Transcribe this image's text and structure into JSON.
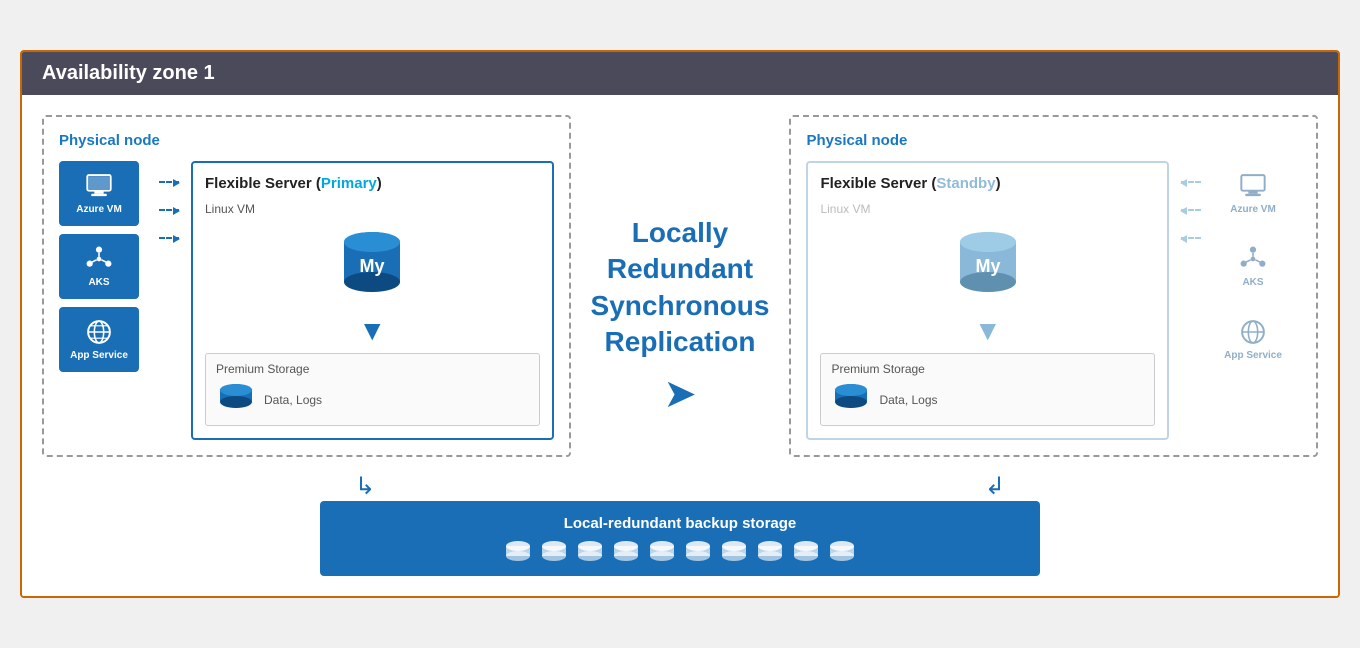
{
  "diagram": {
    "title": "Availability zone 1",
    "left_node": {
      "label": "Physical node",
      "services": [
        {
          "name": "Azure VM",
          "icon": "monitor"
        },
        {
          "name": "AKS",
          "icon": "grid"
        },
        {
          "name": "App Service",
          "icon": "globe"
        }
      ],
      "server": {
        "title": "Flexible Server (",
        "title_color_part": "Primary",
        "title_end": ")",
        "vm_label": "Linux VM",
        "storage_label": "Premium Storage",
        "storage_text": "Data, Logs"
      }
    },
    "right_node": {
      "label": "Physical node",
      "server": {
        "title": "Flexible Server (",
        "title_color_part": "Standby",
        "title_end": ")",
        "vm_label": "Linux VM",
        "storage_label": "Premium Storage",
        "storage_text": "Data, Logs"
      },
      "services": [
        {
          "name": "Azure VM",
          "icon": "monitor",
          "dim": true
        },
        {
          "name": "AKS",
          "icon": "grid",
          "dim": true
        },
        {
          "name": "App Service",
          "icon": "globe",
          "dim": true
        }
      ]
    },
    "replication": {
      "label": "Locally\nRedundant\nSynchronous\nReplication"
    },
    "backup": {
      "label": "Local-redundant backup storage",
      "icon_count": 10
    }
  }
}
